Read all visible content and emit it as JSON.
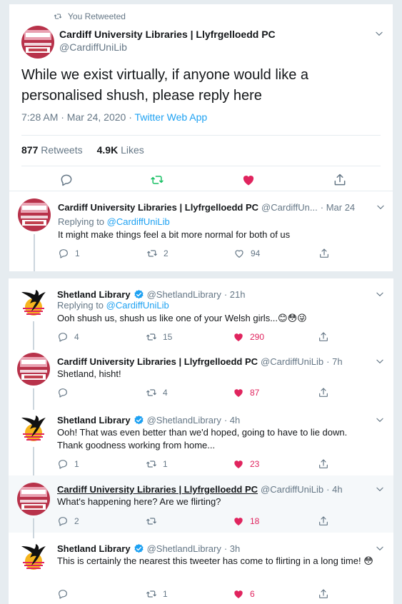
{
  "retweet_notice": "You Retweeted",
  "main_tweet": {
    "author_name": "Cardiff University Libraries | Llyfrgelloedd PC",
    "author_handle": "@CardiffUniLib",
    "text": "While we exist virtually, if anyone would like a personalised shush, please reply here",
    "timestamp": "7:28 AM · Mar 24, 2020 · ",
    "client": "Twitter Web App",
    "retweets_count": "877",
    "retweets_label": "Retweets",
    "likes_count": "4.9K",
    "likes_label": "Likes"
  },
  "replies": [
    {
      "author_name": "Cardiff University Libraries | Llyfrgelloedd PC",
      "author_handle": "@CardiffUn...",
      "time": "· Mar 24",
      "replying_prefix": "Replying to ",
      "replying_to": "@CardiffUniLib",
      "text": "It might make things feel a bit more normal for both of us",
      "reply_count": "1",
      "retweet_count": "2",
      "like_count": "94"
    },
    {
      "author_name": "Shetland Library",
      "author_handle": "@ShetlandLibrary",
      "time": "· 21h",
      "replying_prefix": "Replying to ",
      "replying_to": "@CardiffUniLib",
      "text": "Ooh shush us, shush us like one of your Welsh girls...😊😳😜",
      "reply_count": "4",
      "retweet_count": "15",
      "like_count": "290"
    },
    {
      "author_name": "Cardiff University Libraries | Llyfrgelloedd PC",
      "author_handle": "@CardiffUniLib",
      "time": "· 7h",
      "text": "Shetland, hisht!",
      "reply_count": "",
      "retweet_count": "4",
      "like_count": "87"
    },
    {
      "author_name": "Shetland Library",
      "author_handle": "@ShetlandLibrary",
      "time": "· 4h",
      "text": "Ooh! That was even better than we'd hoped, going to have to lie down. Thank goodness working from home...",
      "reply_count": "1",
      "retweet_count": "1",
      "like_count": "23"
    },
    {
      "author_name": "Cardiff University Libraries | Llyfrgelloedd PC",
      "author_handle": "@CardiffUniLib",
      "time": "· 4h",
      "text": "What's happening here? Are we flirting?",
      "reply_count": "2",
      "retweet_count": "",
      "like_count": "18"
    },
    {
      "author_name": "Shetland Library",
      "author_handle": "@ShetlandLibrary",
      "time": "· 3h",
      "text": "This is certainly the nearest this tweeter has come to flirting in a long time! 😳",
      "reply_count": "",
      "retweet_count": "1",
      "like_count": "6"
    }
  ],
  "colors": {
    "accent": "#1da1f2",
    "like": "#e0245e",
    "retweet": "#17bf63",
    "muted": "#657786"
  },
  "icons": [
    "retweet-icon",
    "reply-icon",
    "heart-icon",
    "share-icon",
    "chevron-down-icon",
    "verified-badge-icon"
  ]
}
